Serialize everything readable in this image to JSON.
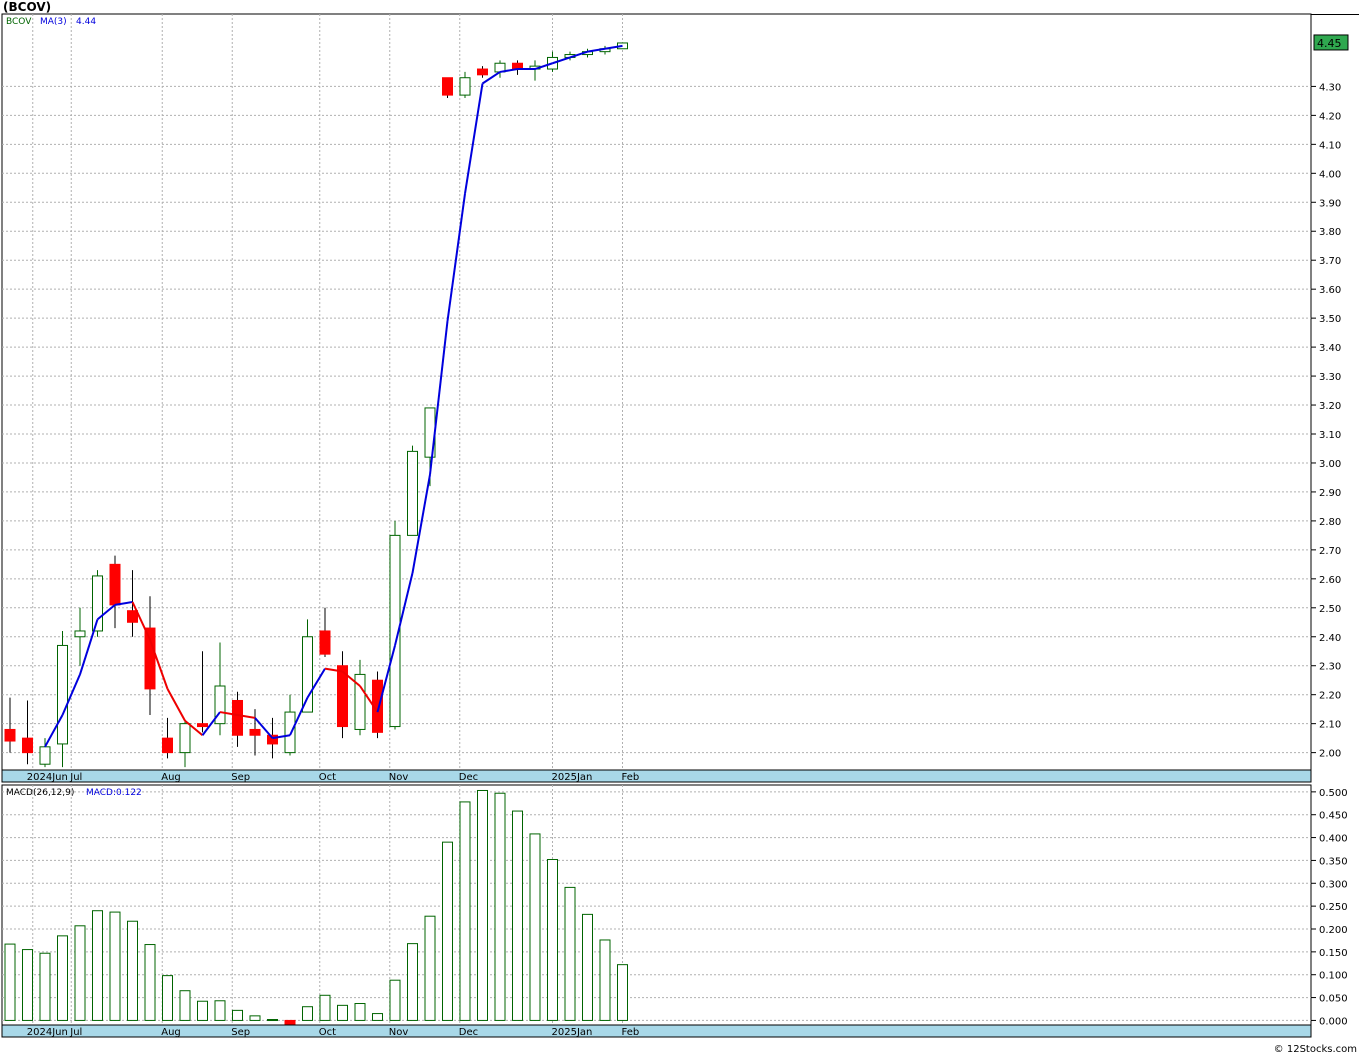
{
  "title": "(BCOV)",
  "copyright": "© 12Stocks.com",
  "colors": {
    "up_candle": "#006400",
    "down_candle": "#ff0000",
    "ma_up": "#0000dd",
    "ma_down": "#ee0000",
    "macd_bar": "#006400",
    "axis_band": "#a8d8e8",
    "grid": "#b0b0b0"
  },
  "chart_data": [
    {
      "type": "candlestick",
      "ticker_label": "BCOV",
      "indicator_label": "MA(3)",
      "indicator_value": "4.44",
      "last_price_label": "4.45",
      "ylim": [
        1.94,
        4.55
      ],
      "y_ticks": [
        "2.00",
        "2.10",
        "2.20",
        "2.30",
        "2.40",
        "2.50",
        "2.60",
        "2.70",
        "2.80",
        "2.90",
        "3.00",
        "3.10",
        "3.20",
        "3.30",
        "3.40",
        "3.50",
        "3.60",
        "3.70",
        "3.80",
        "3.90",
        "4.00",
        "4.10",
        "4.20",
        "4.30"
      ],
      "x_labels": [
        "2024Jun",
        "Jul",
        "Aug",
        "Sep",
        "Oct",
        "Nov",
        "Dec",
        "2025Jan",
        "Feb"
      ],
      "grid": true,
      "candles": [
        {
          "o": 2.08,
          "h": 2.19,
          "l": 2.0,
          "c": 2.04
        },
        {
          "o": 2.05,
          "h": 2.18,
          "l": 1.96,
          "c": 2.0
        },
        {
          "o": 1.96,
          "h": 2.05,
          "l": 1.95,
          "c": 2.02
        },
        {
          "o": 2.03,
          "h": 2.42,
          "l": 1.95,
          "c": 2.37
        },
        {
          "o": 2.4,
          "h": 2.5,
          "l": 2.3,
          "c": 2.42
        },
        {
          "o": 2.42,
          "h": 2.63,
          "l": 2.4,
          "c": 2.61
        },
        {
          "o": 2.65,
          "h": 2.68,
          "l": 2.43,
          "c": 2.51
        },
        {
          "o": 2.49,
          "h": 2.63,
          "l": 2.4,
          "c": 2.45
        },
        {
          "o": 2.43,
          "h": 2.54,
          "l": 2.13,
          "c": 2.22
        },
        {
          "o": 2.05,
          "h": 2.12,
          "l": 1.98,
          "c": 2.0
        },
        {
          "o": 2.0,
          "h": 2.11,
          "l": 1.95,
          "c": 2.1
        },
        {
          "o": 2.1,
          "h": 2.35,
          "l": 2.07,
          "c": 2.09
        },
        {
          "o": 2.1,
          "h": 2.38,
          "l": 2.06,
          "c": 2.23
        },
        {
          "o": 2.18,
          "h": 2.21,
          "l": 2.02,
          "c": 2.06
        },
        {
          "o": 2.08,
          "h": 2.15,
          "l": 1.99,
          "c": 2.06
        },
        {
          "o": 2.06,
          "h": 2.12,
          "l": 1.98,
          "c": 2.03
        },
        {
          "o": 2.0,
          "h": 2.2,
          "l": 1.99,
          "c": 2.14
        },
        {
          "o": 2.14,
          "h": 2.46,
          "l": 2.14,
          "c": 2.4
        },
        {
          "o": 2.42,
          "h": 2.5,
          "l": 2.33,
          "c": 2.34
        },
        {
          "o": 2.3,
          "h": 2.35,
          "l": 2.05,
          "c": 2.09
        },
        {
          "o": 2.08,
          "h": 2.32,
          "l": 2.06,
          "c": 2.27
        },
        {
          "o": 2.25,
          "h": 2.28,
          "l": 2.05,
          "c": 2.07
        },
        {
          "o": 2.09,
          "h": 2.8,
          "l": 2.08,
          "c": 2.75
        },
        {
          "o": 2.75,
          "h": 3.06,
          "l": 2.75,
          "c": 3.04
        },
        {
          "o": 3.02,
          "h": 3.19,
          "l": 2.92,
          "c": 3.19
        },
        {
          "o": 4.33,
          "h": 4.33,
          "l": 4.26,
          "c": 4.27
        },
        {
          "o": 4.27,
          "h": 4.35,
          "l": 4.26,
          "c": 4.33
        },
        {
          "o": 4.36,
          "h": 4.37,
          "l": 4.33,
          "c": 4.34
        },
        {
          "o": 4.35,
          "h": 4.39,
          "l": 4.33,
          "c": 4.38
        },
        {
          "o": 4.38,
          "h": 4.39,
          "l": 4.34,
          "c": 4.36
        },
        {
          "o": 4.36,
          "h": 4.39,
          "l": 4.32,
          "c": 4.37
        },
        {
          "o": 4.36,
          "h": 4.42,
          "l": 4.35,
          "c": 4.4
        },
        {
          "o": 4.4,
          "h": 4.42,
          "l": 4.39,
          "c": 4.41
        },
        {
          "o": 4.41,
          "h": 4.43,
          "l": 4.4,
          "c": 4.42
        },
        {
          "o": 4.42,
          "h": 4.44,
          "l": 4.41,
          "c": 4.43
        },
        {
          "o": 4.43,
          "h": 4.45,
          "l": 4.43,
          "c": 4.45
        }
      ],
      "ma_values": [
        null,
        null,
        2.02,
        2.13,
        2.27,
        2.46,
        2.51,
        2.52,
        2.39,
        2.22,
        2.11,
        2.06,
        2.14,
        2.13,
        2.12,
        2.05,
        2.06,
        2.19,
        2.29,
        2.28,
        2.23,
        2.14,
        2.37,
        2.62,
        2.96,
        3.49,
        3.93,
        4.31,
        4.35,
        4.36,
        4.36,
        4.38,
        4.4,
        4.42,
        4.43,
        4.44
      ],
      "ma_up": [
        true,
        true,
        true,
        true,
        true,
        true,
        true,
        true,
        false,
        false,
        false,
        false,
        true,
        false,
        false,
        true,
        true,
        true,
        true,
        false,
        false,
        false,
        true,
        true,
        true,
        true,
        true,
        true,
        true,
        true,
        true,
        true,
        true,
        true,
        true,
        true
      ]
    },
    {
      "type": "bar",
      "indicator_label": "MACD(26,12,9)",
      "indicator_value": "MACD:0.122",
      "ylim": [
        -0.01,
        0.515
      ],
      "y_ticks": [
        "0.000",
        "0.050",
        "0.100",
        "0.150",
        "0.200",
        "0.250",
        "0.300",
        "0.350",
        "0.400",
        "0.450",
        "0.500"
      ],
      "x_labels": [
        "2024Jun",
        "Jul",
        "Aug",
        "Sep",
        "Oct",
        "Nov",
        "Dec",
        "2025Jan",
        "Feb"
      ],
      "grid": true,
      "values": [
        0.167,
        0.155,
        0.147,
        0.185,
        0.207,
        0.24,
        0.237,
        0.217,
        0.166,
        0.098,
        0.065,
        0.042,
        0.043,
        0.022,
        0.01,
        0.002,
        -0.008,
        0.03,
        0.055,
        0.033,
        0.037,
        0.015,
        0.088,
        0.168,
        0.228,
        0.39,
        0.478,
        0.503,
        0.497,
        0.458,
        0.408,
        0.352,
        0.291,
        0.232,
        0.176,
        0.122
      ]
    }
  ]
}
